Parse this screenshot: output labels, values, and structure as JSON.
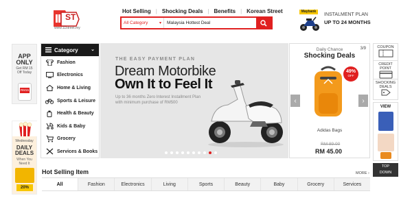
{
  "header": {
    "logo_text": "ST",
    "logo_url": "www.11street.my",
    "nav": [
      "Hot Selling",
      "Shocking Deals",
      "Benefits",
      "Korean Street"
    ],
    "search": {
      "category": "All Category",
      "value": "Malaysia Hottest Deal"
    },
    "installment": {
      "bank": "Maybank",
      "line1": "INSTALMENT PLAN",
      "line2": "UP TO 24 MONTHS"
    }
  },
  "left_ads": {
    "app": {
      "line1": "APP",
      "line2": "ONLY",
      "line3": "Get RM 15",
      "line4": "Off Today",
      "coupon": "RM15"
    },
    "daily": {
      "kicker": "Wednesday",
      "line1": "DAILY",
      "line2": "DEALS",
      "line3": "When You",
      "line4": "Need It",
      "pct": "20%"
    }
  },
  "category_menu": {
    "title": "Category",
    "items": [
      {
        "label": "Fashion",
        "icon": "shirt-icon"
      },
      {
        "label": "Electronics",
        "icon": "tv-icon"
      },
      {
        "label": "Home & Living",
        "icon": "house-icon"
      },
      {
        "label": "Sports & Leisure",
        "icon": "bicycle-icon"
      },
      {
        "label": "Health & Beauty",
        "icon": "bottle-icon"
      },
      {
        "label": "Kids & Baby",
        "icon": "stroller-icon"
      },
      {
        "label": "Grocery",
        "icon": "cart-icon"
      },
      {
        "label": "Services & Books",
        "icon": "utensils-icon"
      }
    ]
  },
  "banner": {
    "kicker": "THE EASY PAYMENT PLAN",
    "title1": "Dream Motorbike",
    "title2": "Own It to Feel It",
    "sub1": "Up to 36 months Zero Interest Installment Plan",
    "sub2": "with minimum purchase of RM500",
    "slide_count": 10,
    "active_slide": 8
  },
  "deals": {
    "kicker": "Daily Chance",
    "title": "Shocking Deals",
    "page": "3/9",
    "badge_pct": "49%",
    "badge_off": "OFF",
    "product": "Adidas Bags",
    "old_price": "RM 89.00",
    "price": "RM 45.00"
  },
  "right_sidebar": {
    "coupon": "COUPON",
    "creditpoint": "CREDIT POINT",
    "shocking": "SHOCKING DEALS",
    "view": "VIEW",
    "top": "TOP",
    "down": "DOWN"
  },
  "hot_selling": {
    "title": "Hot Selling Item",
    "more": "MORE",
    "tabs": [
      "All",
      "Fashion",
      "Electronics",
      "Living",
      "Sports",
      "Beauty",
      "Baby",
      "Grocery",
      "Services"
    ]
  },
  "colors": {
    "brand_red": "#e02020",
    "dark": "#1a1a1a"
  }
}
